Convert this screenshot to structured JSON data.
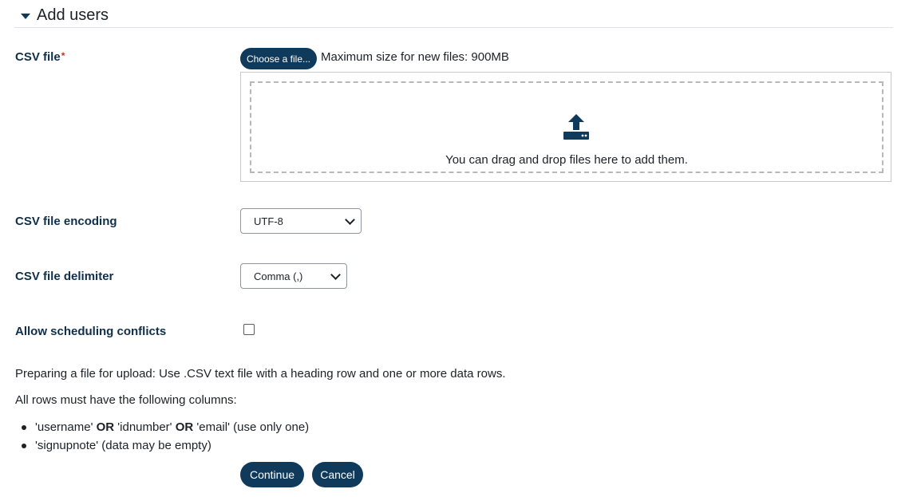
{
  "section": {
    "title": "Add users"
  },
  "csv_file": {
    "label": "CSV file",
    "required_marker": "*",
    "choose_button": "Choose a file...",
    "max_size_text": "Maximum size for new files: 900MB",
    "dropzone_text": "You can drag and drop files here to add them."
  },
  "encoding": {
    "label": "CSV file encoding",
    "selected": "UTF-8"
  },
  "delimiter": {
    "label": "CSV file delimiter",
    "selected": "Comma (,)"
  },
  "scheduling": {
    "label": "Allow scheduling conflicts",
    "checked": false
  },
  "help": {
    "preparing": "Preparing a file for upload: Use .CSV text file with a heading row and one or more data rows.",
    "columns_intro": "All rows must have the following columns:",
    "columns": [
      {
        "part1": "'username' ",
        "or1": "OR",
        "part2": " 'idnumber' ",
        "or2": "OR",
        "part3": " 'email' (use only one)"
      },
      {
        "text": "'signupnote' (data may be empty)"
      }
    ]
  },
  "buttons": {
    "continue": "Continue",
    "cancel": "Cancel"
  },
  "colors": {
    "primary": "#0f3a5c",
    "required": "#ca3120"
  }
}
